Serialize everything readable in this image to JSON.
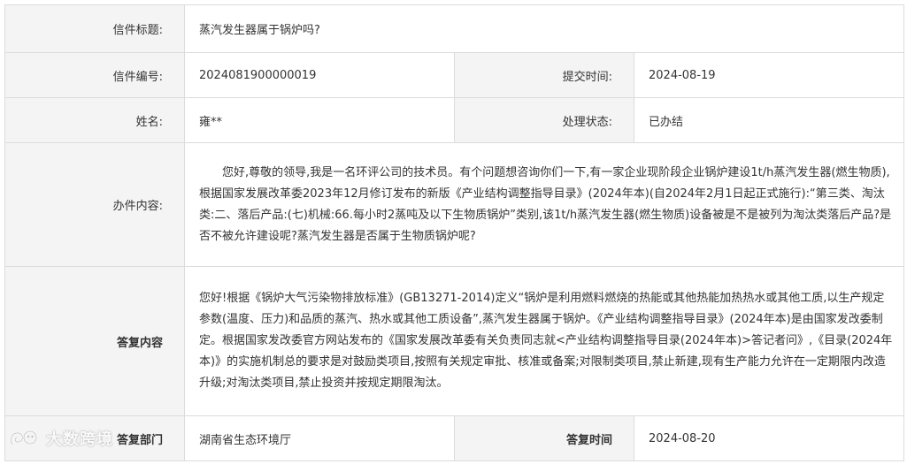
{
  "letter": {
    "title_label": "信件标题:",
    "title_value": "蒸汽发生器属于锅炉吗?",
    "number_label": "信件编号:",
    "number_value": "2024081900000019",
    "submit_time_label": "提交时间:",
    "submit_time_value": "2024-08-19",
    "name_label": "姓名:",
    "name_value": "雍**",
    "status_label": "处理状态:",
    "status_value": "已办结",
    "content_label": "办件内容:",
    "content_value": "您好,尊敬的领导,我是一名环评公司的技术员。有个问题想咨询你们一下,有一家企业现阶段企业锅炉建设1t/h蒸汽发生器(燃生物质),根据国家发展改革委2023年12月修订发布的新版《产业结构调整指导目录》(2024年本)(自2024年2月1日起正式施行):“第三类、淘汰类:二、落后产品:(七)机械:66.每小时2蒸吨及以下生物质锅炉”类别,该1t/h蒸汽发生器(燃生物质)设备被是不是被列为淘汰类落后产品?是否不被允许建设呢?蒸汽发生器是否属于生物质锅炉呢?",
    "reply_label": "答复内容",
    "reply_value": "您好!根据《锅炉大气污染物排放标准》(GB13271-2014)定义“锅炉是利用燃料燃烧的热能或其他热能加热热水或其他工质,以生产规定参数(温度、压力)和品质的蒸汽、热水或其他工质设备”,蒸汽发生器属于锅炉。《产业结构调整指导目录》(2024年本)是由国家发改委制定。根据国家发改委官方网站发布的《国家发展改革委有关负责同志就<产业结构调整指导目录(2024年本)>答记者问》,《目录(2024年本)》的实施机制总的要求是对鼓励类项目,按照有关规定审批、核准或备案;对限制类项目,禁止新建,现有生产能力允许在一定期限内改造升级;对淘汰类项目,禁止投资并按规定期限淘汰。",
    "dept_label": "答复部门",
    "dept_value": "湖南省生态环境厅",
    "reply_time_label": "答复时间",
    "reply_time_value": "2024-08-20"
  },
  "watermark": {
    "text": "大数跨境",
    "icon": "logo-swirl-icon"
  }
}
